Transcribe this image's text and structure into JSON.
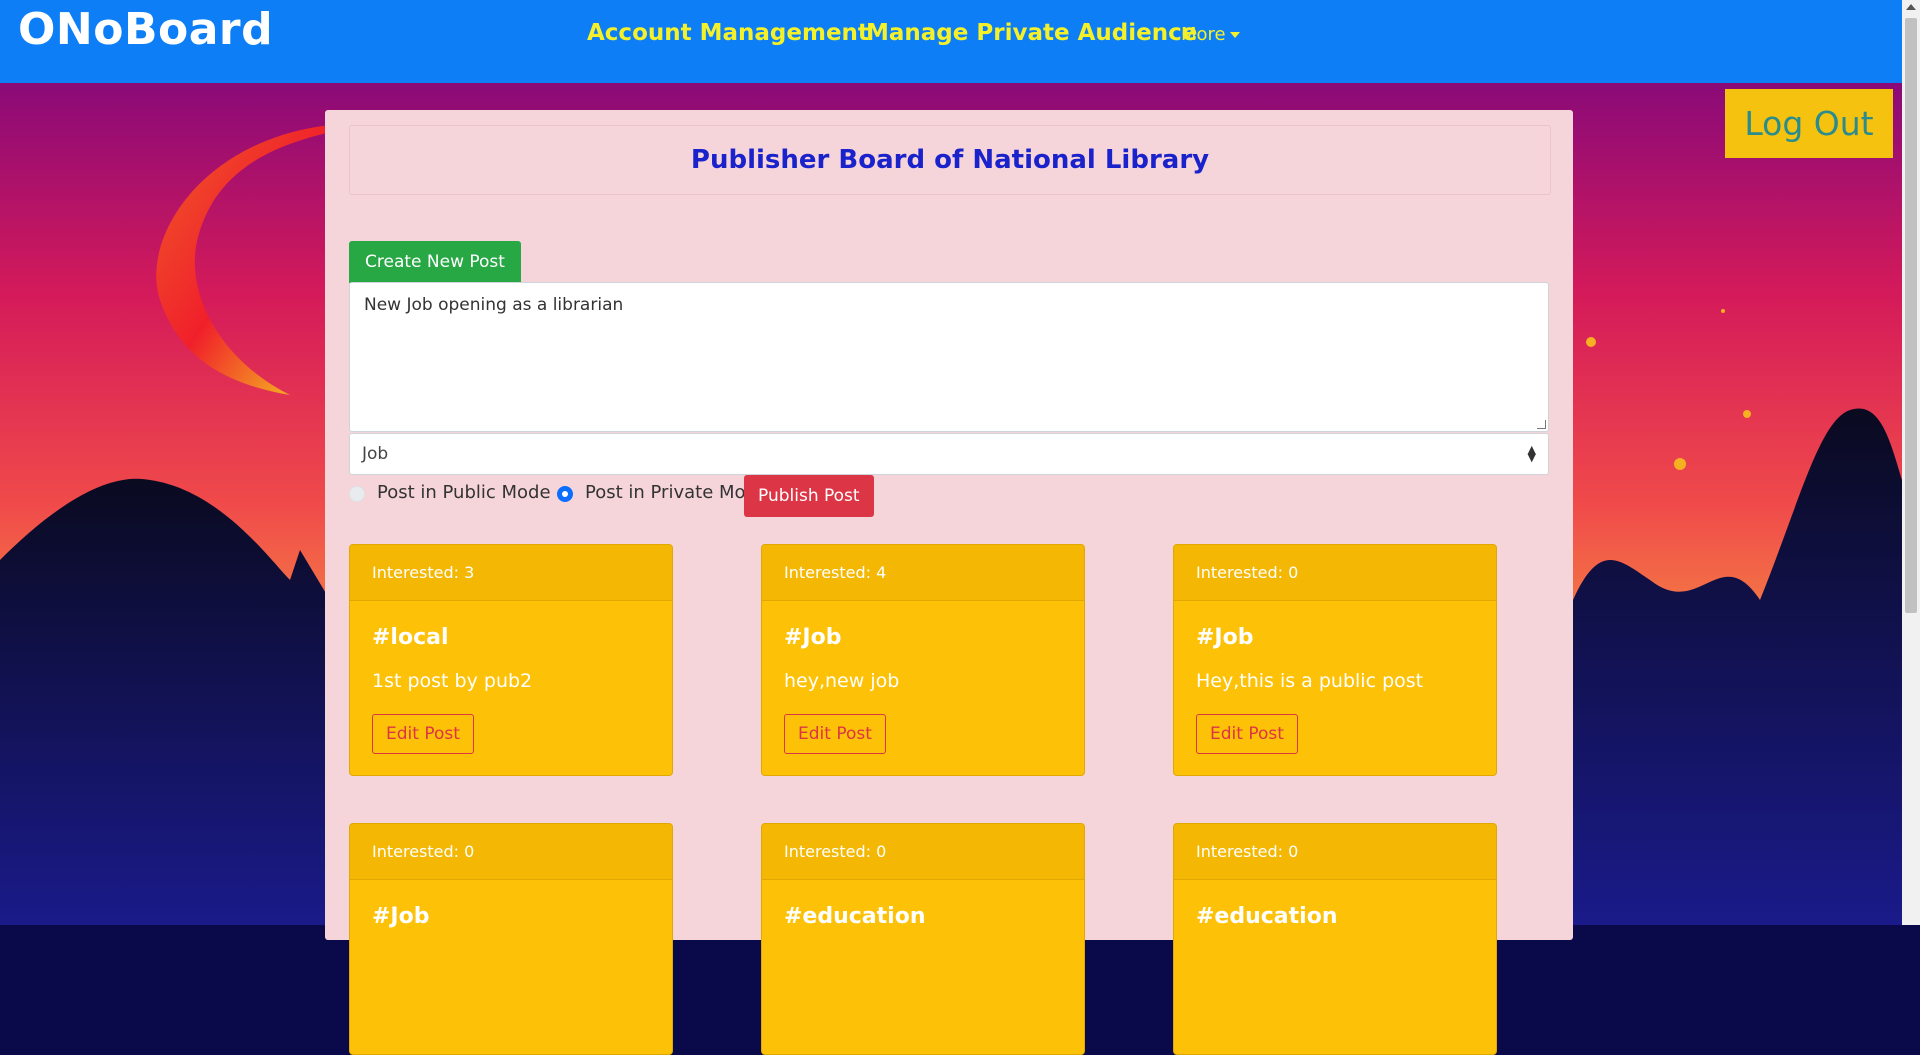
{
  "navbar": {
    "brand": "ONoBoard",
    "links": [
      "Account Management",
      "Manage Private Audience"
    ],
    "more_label": "More"
  },
  "logout_label": "Log Out",
  "board": {
    "title": "Publisher Board of National Library",
    "create_label": "Create New Post",
    "post_text": "New Job opening as a librarian",
    "category_selected": "Job",
    "public_mode_label": "Post in Public Mode",
    "private_mode_label": "Post in Private Mode",
    "selected_mode": "private",
    "publish_label": "Publish Post"
  },
  "edit_label": "Edit Post",
  "cards": [
    {
      "interested": "Interested: 3",
      "tag": "#local",
      "text": "1st post by pub2"
    },
    {
      "interested": "Interested: 4",
      "tag": "#Job",
      "text": "hey,new job"
    },
    {
      "interested": "Interested: 0",
      "tag": "#Job",
      "text": "Hey,this is a public post"
    },
    {
      "interested": "Interested: 0",
      "tag": "#Job",
      "text": ""
    },
    {
      "interested": "Interested: 0",
      "tag": "#education",
      "text": ""
    },
    {
      "interested": "Interested: 0",
      "tag": "#education",
      "text": ""
    }
  ],
  "colors": {
    "navbar": "#0d7ef5",
    "nav_link": "#f4f12a",
    "card": "#fdc107",
    "panel": "#f5d5d9",
    "logout_bg": "#f5c20f"
  }
}
